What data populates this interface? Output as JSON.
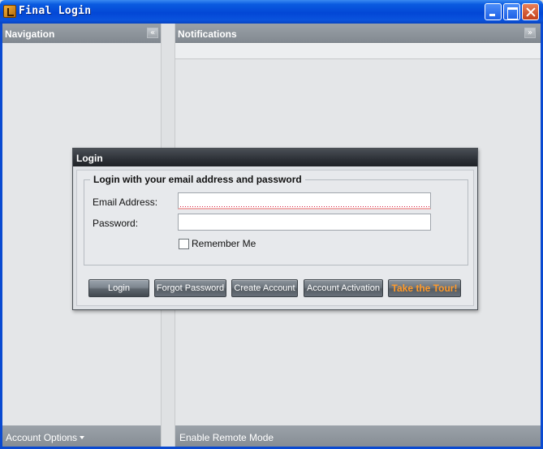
{
  "window": {
    "title": "Final Login"
  },
  "navigation": {
    "header": "Navigation",
    "collapse_glyph": "«",
    "footer": "Account Options"
  },
  "notifications": {
    "header": "Notifications",
    "expand_glyph": "»",
    "footer": "Enable Remote Mode"
  },
  "login_dialog": {
    "title": "Login",
    "legend": "Login with your email address and password",
    "email_label": "Email Address:",
    "email_value": "",
    "password_label": "Password:",
    "password_value": "",
    "remember_label": "Remember Me",
    "remember_checked": false,
    "buttons": {
      "login": "Login",
      "forgot": "Forgot Password",
      "create": "Create Account",
      "activate": "Account Activation",
      "tour": "Take the Tour!"
    }
  },
  "icons": {
    "app": "app-logo-icon",
    "minimize": "minimize-icon",
    "maximize": "maximize-icon",
    "close": "close-icon"
  },
  "colors": {
    "titlebar": "#0347d6",
    "tour_accent": "#ff9a2a",
    "panel_header": "#8a9198"
  }
}
